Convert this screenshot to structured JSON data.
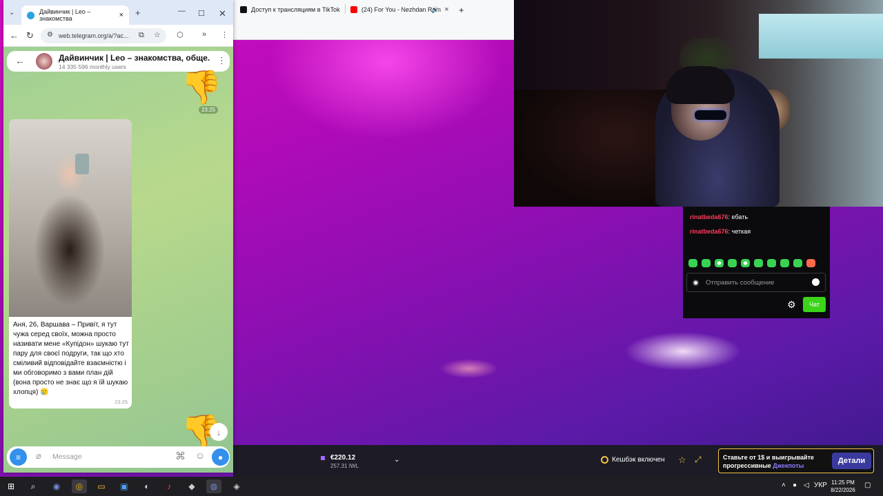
{
  "browser_bg": {
    "tabs": [
      {
        "label": "Доступ к трансляциям в TikTok",
        "favicon_color": "#111111"
      },
      {
        "label": "(24) For You - Nezhdan Rem",
        "favicon_color": "#ff0000"
      }
    ],
    "new_tab": "+"
  },
  "chat": {
    "messages": [
      {
        "user": "rinatbeda676",
        "sep": ":",
        "text": " ебать"
      },
      {
        "user": "rinatbeda676",
        "sep": ":",
        "text": " четкая"
      }
    ],
    "input_placeholder": "Отправить сообщение",
    "send_label": "Чат",
    "accent_color": "#3bd41a"
  },
  "casino_bar": {
    "balance_main": "€220.12",
    "balance_sub": "257.31 IWL",
    "cashback": "Кешбэк включен",
    "promo_text_1": "Ставьте от 1$ и выигрывайте",
    "promo_text_2": "прогрессивные",
    "promo_highlight": "Джекпоты",
    "promo_button": "Детали"
  },
  "telegram": {
    "tab_title": "Дайвинчик | Leo – знакомства",
    "url": "web.telegram.org/a/?ac...",
    "chat_title": "Дайвинчик | Leo – знакомства, обще...",
    "chat_subtitle": "14 335 596 monthly users",
    "time_top": "23:25",
    "message_text": "Аня, 26, Варшава – Привіт, я тут чужа серед своїх, можна просто називати мене «Купідон» шукаю тут пару для своєї подруги, так що хто сміливий відповідайте взаємністю і ми обговоримо з вами план дій (вона просто не знає що я їй шукаю хлопця) 🥲",
    "message_time": "23:25",
    "composer_placeholder": "Message",
    "thumb_emoji": "👎"
  },
  "taskbar": {
    "language": "УКР",
    "time": "11:25 PM",
    "date": "8/22/2026"
  }
}
